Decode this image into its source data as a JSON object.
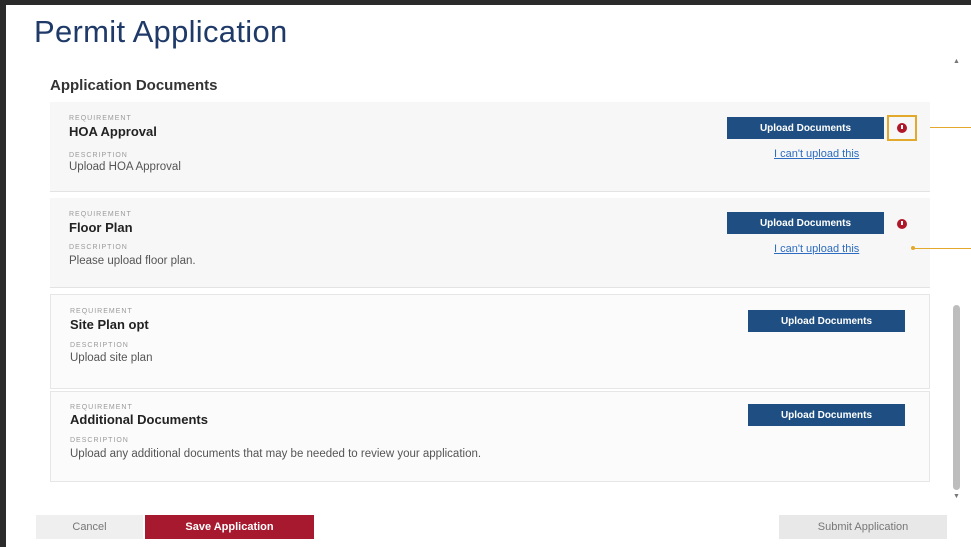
{
  "page": {
    "title": "Permit Application"
  },
  "section": {
    "title": "Application Documents"
  },
  "labels": {
    "requirement": "REQUIREMENT",
    "description": "DESCRIPTION"
  },
  "requirements": [
    {
      "name": "HOA Approval",
      "description": "Upload HOA Approval",
      "upload_label": "Upload Documents",
      "cant_upload_label": "I can't upload this",
      "has_alert": true,
      "highlighted": true
    },
    {
      "name": "Floor Plan",
      "description": "Please upload floor plan.",
      "upload_label": "Upload Documents",
      "cant_upload_label": "I can't upload this",
      "has_alert": true
    },
    {
      "name": "Site Plan opt",
      "description": "Upload site plan",
      "upload_label": "Upload Documents"
    },
    {
      "name": "Additional Documents",
      "description": "Upload any additional documents that may be needed to review your application.",
      "upload_label": "Upload Documents"
    }
  ],
  "footer": {
    "cancel_label": "Cancel",
    "save_label": "Save Application",
    "submit_label": "Submit Application"
  },
  "colors": {
    "title": "#1f3a68",
    "upload_button": "#1f4f82",
    "save_button": "#a6192e",
    "alert": "#b0182a",
    "highlight": "#e3a92c",
    "link": "#2d6cc0"
  }
}
